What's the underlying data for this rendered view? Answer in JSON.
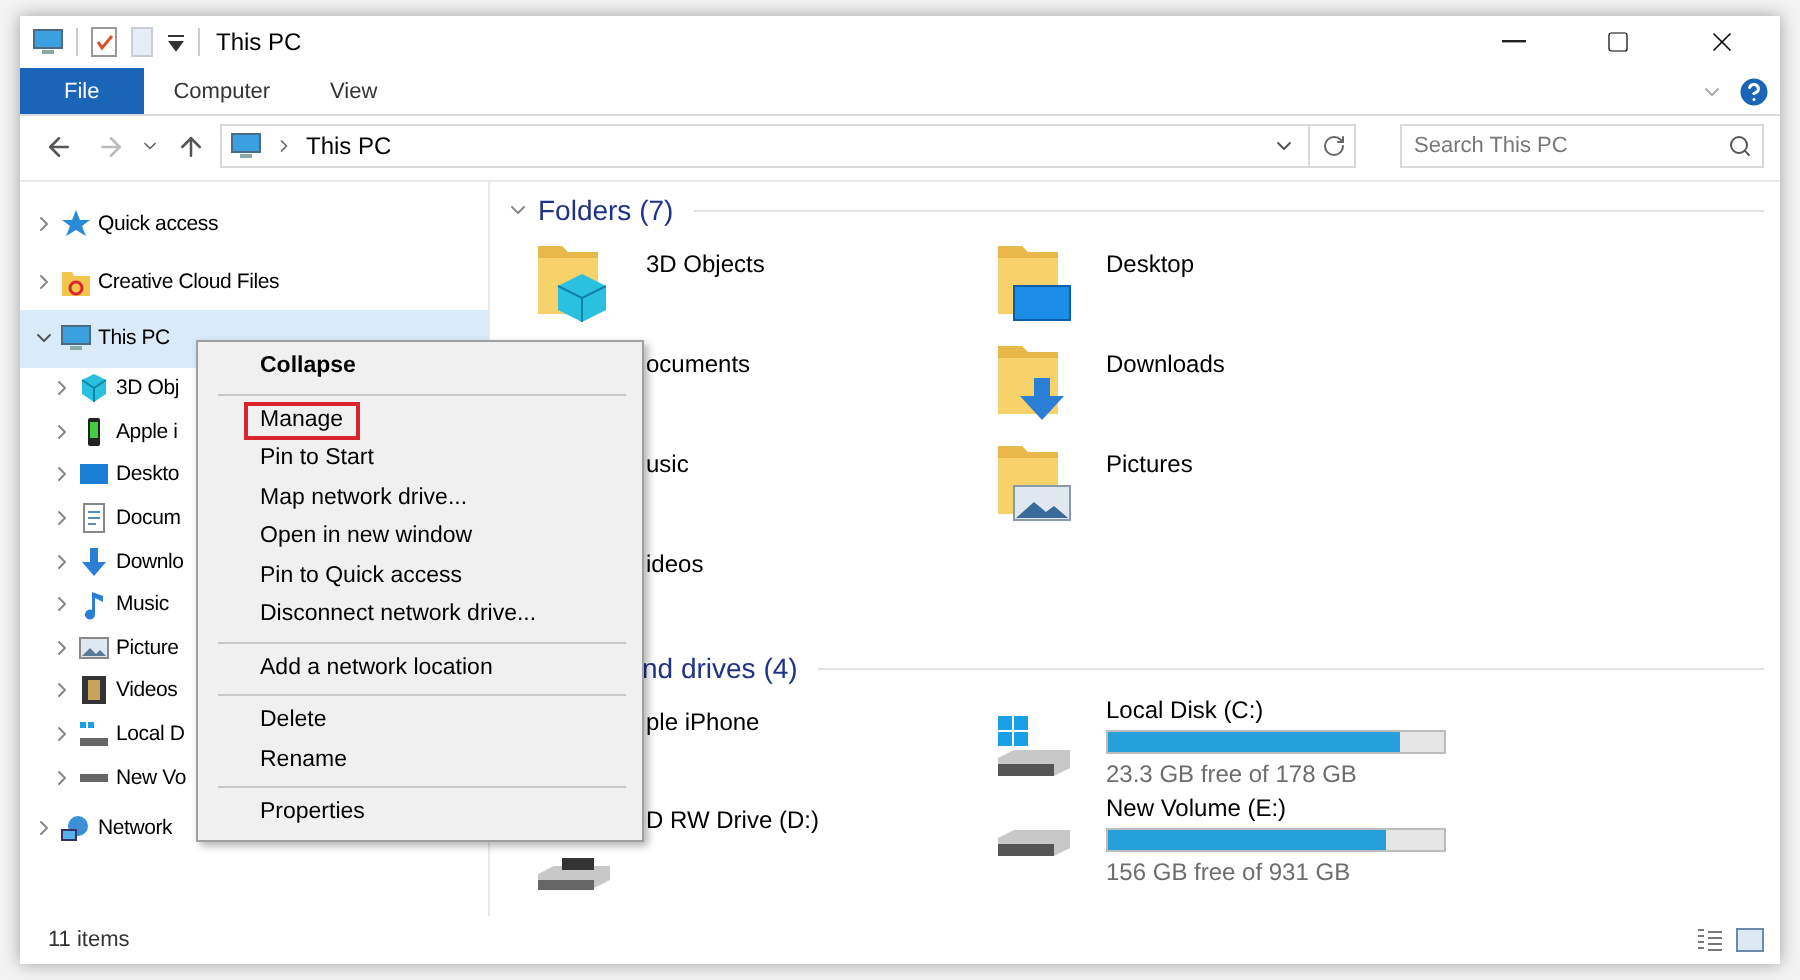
{
  "window": {
    "title": "This PC"
  },
  "ribbon": {
    "tabs": [
      {
        "label": "File",
        "selected": true
      },
      {
        "label": "Computer",
        "selected": false
      },
      {
        "label": "View",
        "selected": false
      }
    ]
  },
  "address": {
    "path": "This PC"
  },
  "search": {
    "placeholder": "Search This PC"
  },
  "sidebar": {
    "items": [
      {
        "label": "Quick access",
        "kind": "star",
        "expanded": false,
        "selected": false
      },
      {
        "label": "Creative Cloud Files",
        "kind": "cloudfolder",
        "expanded": false,
        "selected": false
      },
      {
        "label": "This PC",
        "kind": "pc",
        "expanded": true,
        "selected": true,
        "children": [
          {
            "label": "3D Obj",
            "kind": "cube",
            "expanded": false,
            "selected": false
          },
          {
            "label": "Apple i",
            "kind": "phone",
            "expanded": false,
            "selected": false
          },
          {
            "label": "Deskto",
            "kind": "desktop",
            "expanded": false,
            "selected": false
          },
          {
            "label": "Docum",
            "kind": "doc",
            "expanded": false,
            "selected": false
          },
          {
            "label": "Downlo",
            "kind": "download",
            "expanded": false,
            "selected": false
          },
          {
            "label": "Music",
            "kind": "note",
            "expanded": false,
            "selected": false
          },
          {
            "label": "Picture",
            "kind": "picture",
            "expanded": false,
            "selected": false
          },
          {
            "label": "Videos",
            "kind": "video",
            "expanded": false,
            "selected": false
          },
          {
            "label": "Local D",
            "kind": "windisk",
            "expanded": false,
            "selected": false
          },
          {
            "label": "New Vo",
            "kind": "disk",
            "expanded": false,
            "selected": false
          }
        ]
      },
      {
        "label": "Network",
        "kind": "network",
        "expanded": false,
        "selected": false
      }
    ]
  },
  "sections": [
    {
      "title": "Folders (7)",
      "expanded": true,
      "items": [
        {
          "label": "3D Objects",
          "kind": "cube"
        },
        {
          "label": "Desktop",
          "kind": "desktop"
        },
        {
          "label": "ocuments"
        },
        {
          "label": "Downloads",
          "kind": "download"
        },
        {
          "label": "usic"
        },
        {
          "label": "Pictures",
          "kind": "picture"
        },
        {
          "label": "ideos"
        }
      ]
    },
    {
      "title": "nd drives (4)",
      "items": [
        {
          "label": "ple iPhone"
        },
        {
          "label": "Local Disk (C:)",
          "kind": "windisk",
          "level": 0.87,
          "free": "23.3 GB free of 178 GB"
        },
        {
          "label": "D RW Drive (D:)",
          "kind": "dvd"
        },
        {
          "label": "New Volume (E:)",
          "kind": "disk",
          "level": 0.83,
          "free": "156 GB free of 931 GB"
        }
      ]
    }
  ],
  "context_menu": {
    "groups": [
      [
        {
          "label": "Collapse",
          "bold": true,
          "highlighted": false
        }
      ],
      [
        {
          "label": "Manage",
          "bold": false,
          "highlighted": true
        },
        {
          "label": "Pin to Start",
          "bold": false,
          "highlighted": false
        },
        {
          "label": "Map network drive...",
          "bold": false,
          "highlighted": false
        },
        {
          "label": "Open in new window",
          "bold": false,
          "highlighted": false
        },
        {
          "label": "Pin to Quick access",
          "bold": false,
          "highlighted": false
        },
        {
          "label": "Disconnect network drive...",
          "bold": false,
          "highlighted": false
        }
      ],
      [
        {
          "label": "Add a network location",
          "bold": false,
          "highlighted": false
        }
      ],
      [
        {
          "label": "Delete",
          "bold": false,
          "highlighted": false
        },
        {
          "label": "Rename",
          "bold": false,
          "highlighted": false
        }
      ],
      [
        {
          "label": "Properties",
          "bold": false,
          "highlighted": false
        }
      ]
    ]
  },
  "status_bar": {
    "count": "11 items"
  }
}
